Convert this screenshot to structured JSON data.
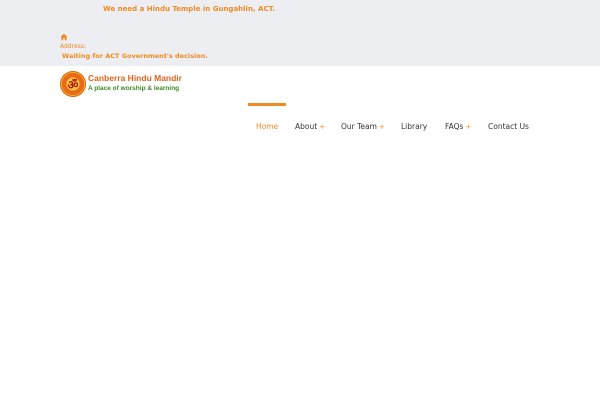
{
  "topbar": {
    "announcement": "We need a Hindu Temple in Gungahlin, ACT.",
    "home_icon": "home-icon",
    "address_label": "Address:",
    "address_value": "Waiting for ACT Government's decision."
  },
  "logo": {
    "name": "Canberra Hindu Mandir",
    "tagline": "A place of worship & learning",
    "emblem_glyph": "ॐ"
  },
  "nav": {
    "items": [
      {
        "label": "Home",
        "has_submenu": false,
        "active": true
      },
      {
        "label": "About",
        "has_submenu": true,
        "active": false
      },
      {
        "label": "Our Team",
        "has_submenu": true,
        "active": false
      },
      {
        "label": "Library",
        "has_submenu": false,
        "active": false
      },
      {
        "label": "FAQs",
        "has_submenu": true,
        "active": false
      },
      {
        "label": "Contact Us",
        "has_submenu": false,
        "active": false
      }
    ],
    "submenu_marker": "+"
  },
  "colors": {
    "accent": "#f08a24",
    "topbar_bg": "#eceef1",
    "text": "#333333",
    "tagline_green": "#3f8a27"
  }
}
